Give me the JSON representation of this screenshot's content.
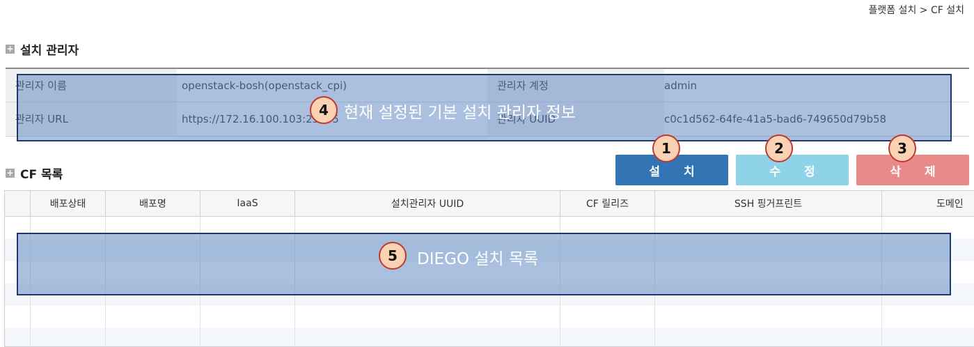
{
  "breadcrumb": "플랫폼 설치 > CF 설치",
  "director_section": {
    "title": "설치 관리자",
    "fields": [
      {
        "label": "관리자 이름",
        "value": "openstack-bosh(openstack_cpi)"
      },
      {
        "label": "관리자 계정",
        "value": "admin"
      },
      {
        "label": "관리자 URL",
        "value": "https://172.16.100.103:25555"
      },
      {
        "label": "관리자 UUID",
        "value": "c0c1d562-64fe-41a5-bad6-749650d79b58"
      }
    ]
  },
  "cf_section": {
    "title": "CF 목록",
    "buttons": {
      "install": "설 치",
      "edit": "수 정",
      "delete": "삭 제"
    },
    "columns": [
      "배포상태",
      "배포명",
      "IaaS",
      "설치관리자 UUID",
      "CF 릴리즈",
      "SSH 핑거프린트",
      "도메인"
    ]
  },
  "annotations": {
    "badge1": "1",
    "badge2": "2",
    "badge3": "3",
    "badge4": "4",
    "note4": "현재 설정된 기본 설치 관리자 정보",
    "badge5": "5",
    "note5": "DIEGO 설치 목록"
  },
  "colors": {
    "install_button": "#3374b5",
    "edit_button": "#8fd3e8",
    "delete_button": "#e88a8a",
    "overlay": "#5682be",
    "badge_fill": "#fbd2b4",
    "badge_border": "#c0392b"
  }
}
